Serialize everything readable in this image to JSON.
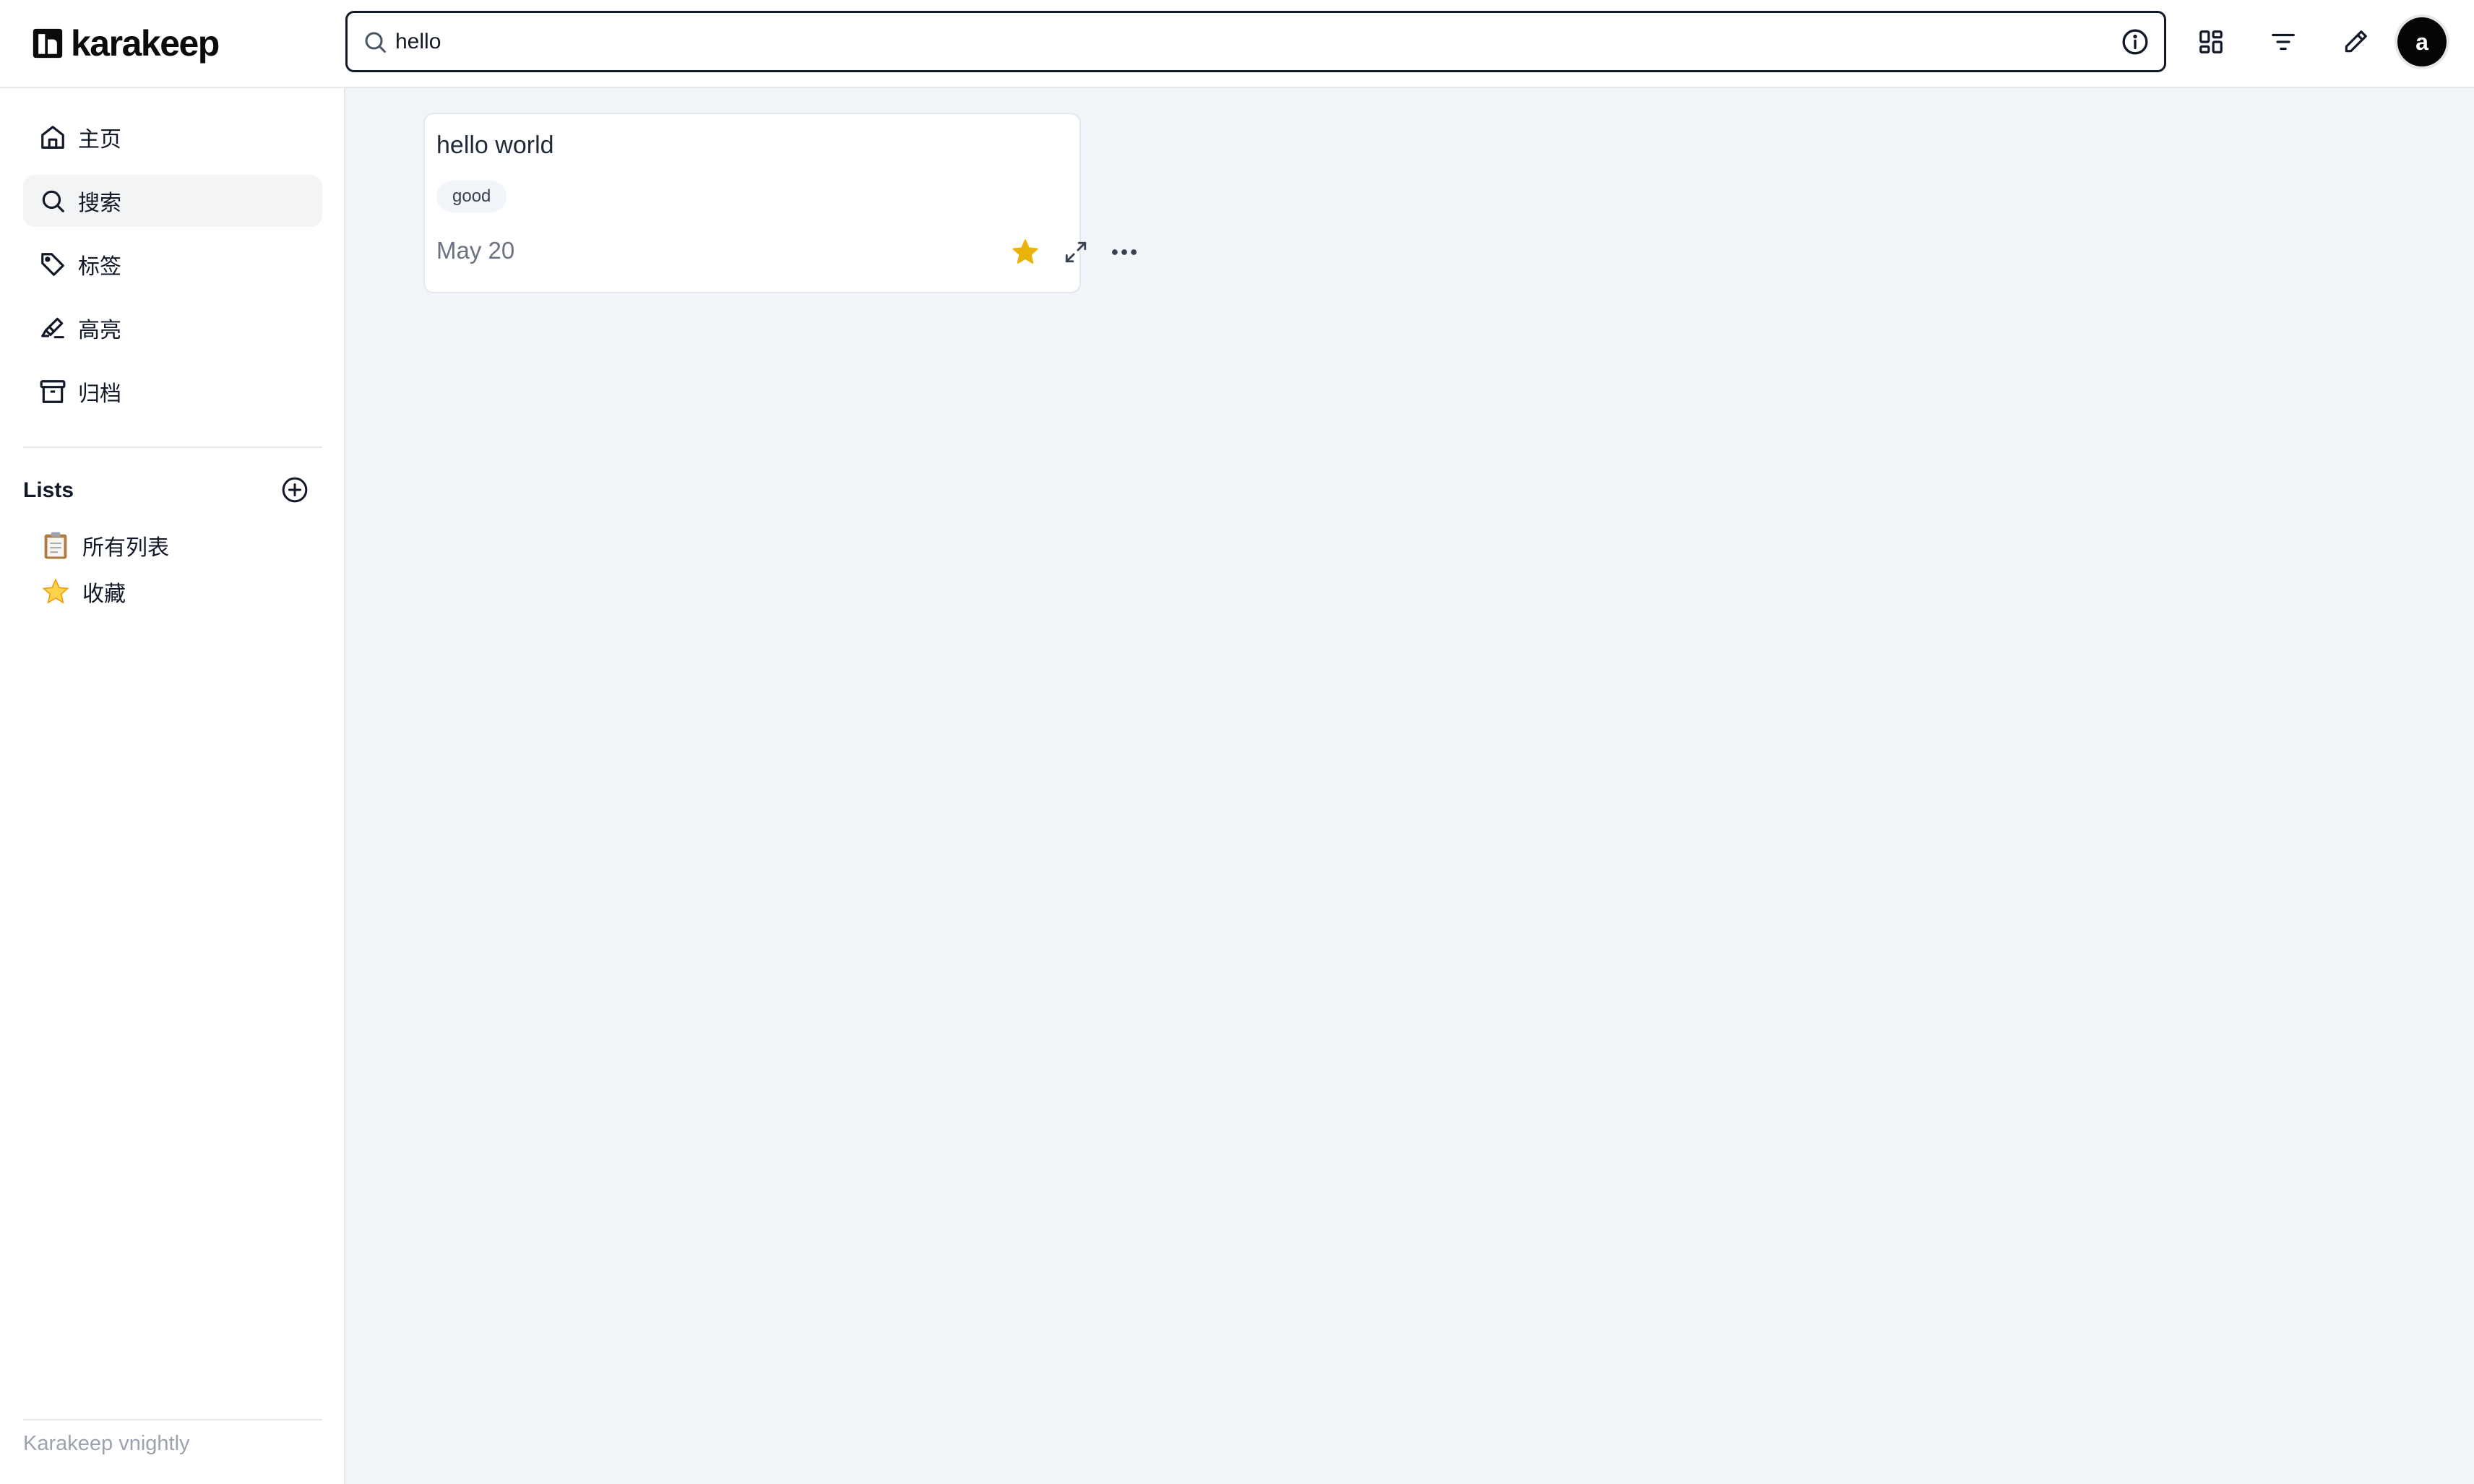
{
  "app": {
    "name": "karakeep",
    "version_label": "Karakeep vnightly"
  },
  "header": {
    "search_value": "hello",
    "search_placeholder": "",
    "avatar_initial": "a"
  },
  "sidebar": {
    "items": [
      {
        "label": "主页",
        "icon": "home-icon",
        "active": false
      },
      {
        "label": "搜索",
        "icon": "search-icon",
        "active": true
      },
      {
        "label": "标签",
        "icon": "tag-icon",
        "active": false
      },
      {
        "label": "高亮",
        "icon": "highlighter-icon",
        "active": false
      },
      {
        "label": "归档",
        "icon": "archive-icon",
        "active": false
      }
    ],
    "lists_title": "Lists",
    "lists": [
      {
        "label": "所有列表",
        "icon": "clipboard-emoji"
      },
      {
        "label": "收藏",
        "icon": "star-emoji"
      }
    ]
  },
  "bookmarks": [
    {
      "title": "hello world",
      "tags": [
        "good"
      ],
      "date": "May 20",
      "favourited": true
    }
  ],
  "colors": {
    "accent_star": "#EAB308",
    "main_background": "#F1F5F9",
    "active_nav": "#F3F4F6",
    "border": "#E5E7EB"
  }
}
